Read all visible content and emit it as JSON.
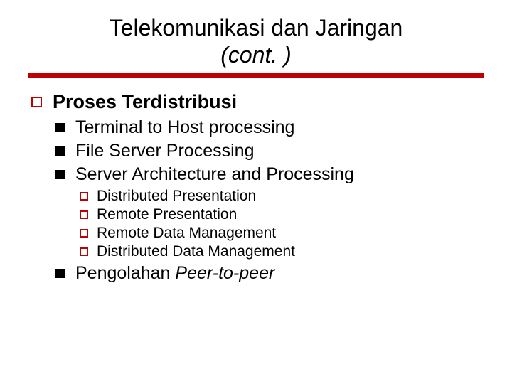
{
  "title_line1": "Telekomunikasi dan Jaringan",
  "title_line2": "(cont. )",
  "main": {
    "heading": "Proses Terdistribusi",
    "items": [
      {
        "text": "Terminal to Host processing"
      },
      {
        "text": "File Server Processing"
      },
      {
        "text": "Server Architecture and Processing",
        "sub": [
          "Distributed Presentation",
          "Remote Presentation",
          "Remote Data Management",
          "Distributed Data Management"
        ]
      },
      {
        "prefix": "Pengolahan ",
        "italic": "Peer-to-peer"
      }
    ]
  }
}
